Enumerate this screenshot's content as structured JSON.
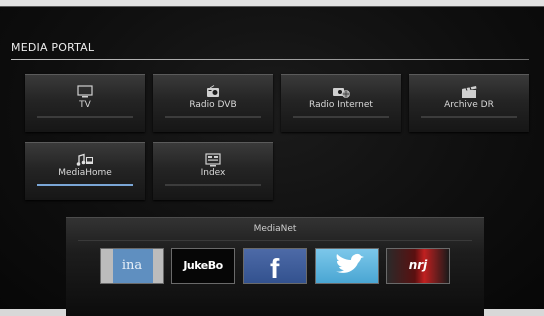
{
  "portal": {
    "title": "MEDIA PORTAL"
  },
  "tiles": [
    {
      "label": "TV",
      "icon": "tv-icon"
    },
    {
      "label": "Radio DVB",
      "icon": "radio-icon"
    },
    {
      "label": "Radio Internet",
      "icon": "internet-radio-icon"
    },
    {
      "label": "Archive DR",
      "icon": "film-icon"
    },
    {
      "label": "MediaHome",
      "icon": "media-home-icon",
      "focused": true
    },
    {
      "label": "Index",
      "icon": "index-icon"
    }
  ],
  "medianet": {
    "title": "MediaNet",
    "apps": [
      {
        "label": "ina"
      },
      {
        "label": "JukeBo"
      },
      {
        "label": "f"
      },
      {
        "label": ""
      },
      {
        "label": "nrj"
      }
    ]
  },
  "colors": {
    "focus_bar": "#7aa6d6",
    "background": "#0f0f0f"
  }
}
